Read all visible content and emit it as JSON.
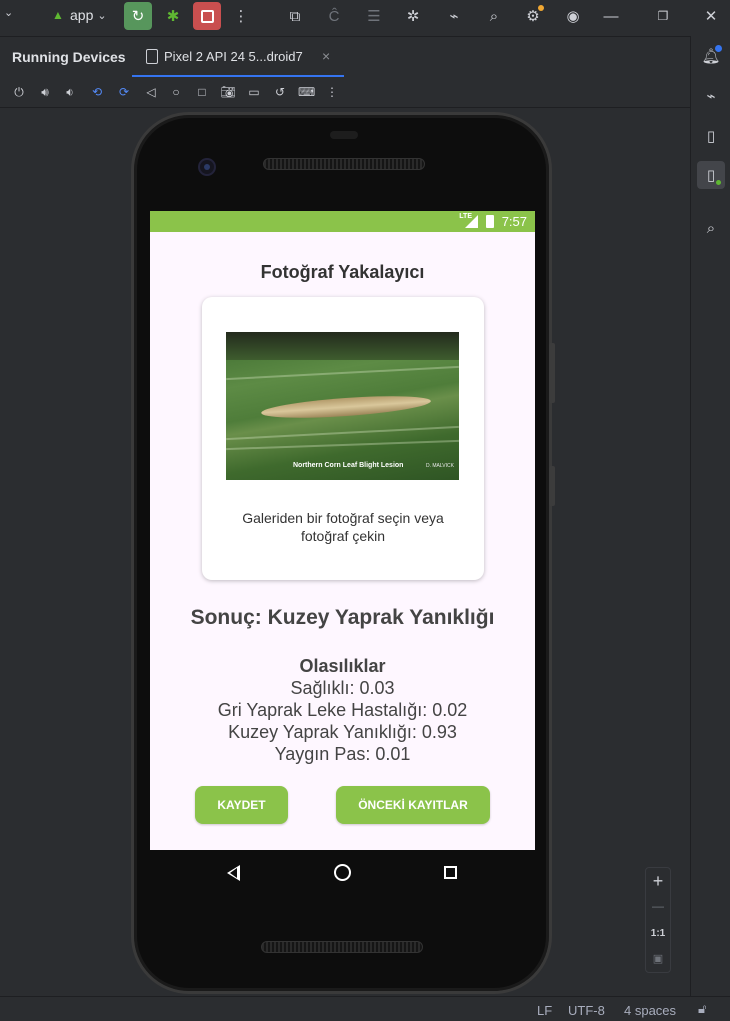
{
  "toolbar": {
    "app_label": "app"
  },
  "tabs": {
    "running_devices": "Running Devices",
    "device_tab": "Pixel 2 API 24 5...droid7",
    "close": "×"
  },
  "status_bar": {
    "line_ending": "LF",
    "encoding": "UTF-8",
    "indent": "4 spaces"
  },
  "zoom": {
    "zoom_in": "+",
    "zoom_out": "—",
    "actual_size": "1:1"
  },
  "phone": {
    "status": {
      "network": "LTE",
      "time": "7:57"
    },
    "screen": {
      "title": "Fotoğraf Yakalayıcı",
      "photo_caption": "Northern Corn Leaf Blight Lesion",
      "photo_credit": "D. MALVICK",
      "card_text": "Galeriden bir fotoğraf seçin veya fotoğraf çekin",
      "result": "Sonuç: Kuzey Yaprak Yanıklığı",
      "probabilities_title": "Olasılıklar",
      "probabilities": [
        "Sağlıklı: 0.03",
        "Gri Yaprak Leke Hastalığı: 0.02",
        "Kuzey Yaprak Yanıklığı: 0.93",
        "Yaygın Pas: 0.01"
      ],
      "save_button": "KAYDET",
      "history_button": "ÖNCEKİ KAYITLAR"
    }
  },
  "colors": {
    "accent_green": "#8bc34a",
    "ide_background": "#2b2d30",
    "app_background": "#fef7ff",
    "tab_underline": "#3574f0"
  }
}
